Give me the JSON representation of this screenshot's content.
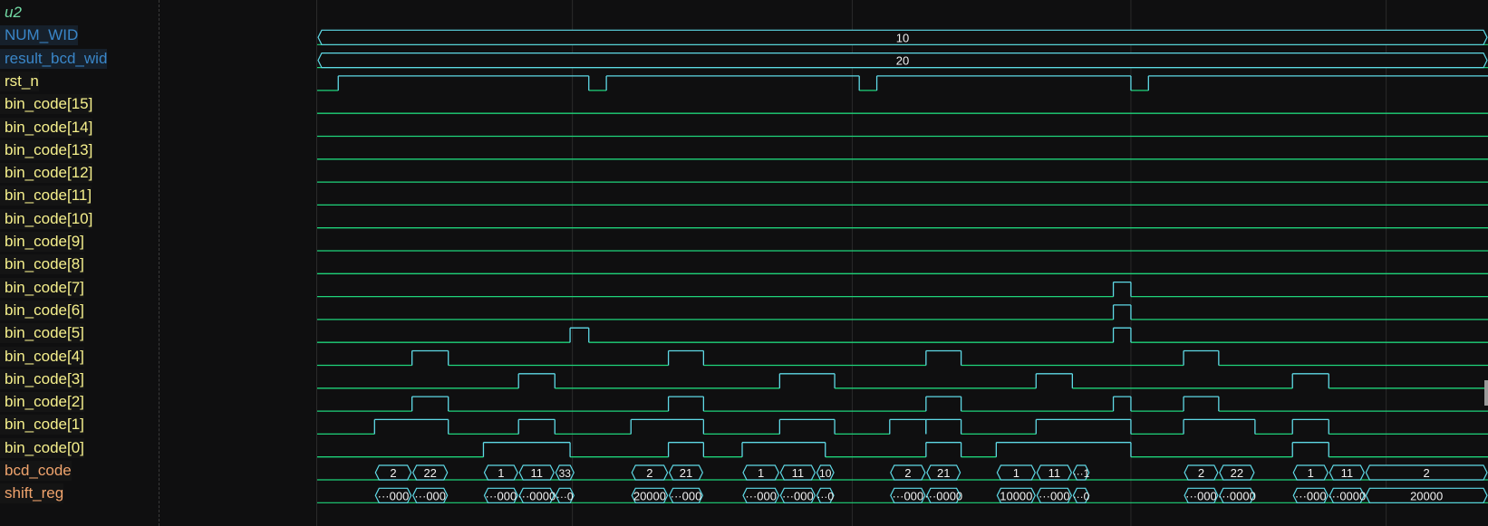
{
  "signals": [
    {
      "name": "u2",
      "kind": "group"
    },
    {
      "name": "NUM_WID",
      "kind": "param",
      "wave": "bus",
      "segments": [
        {
          "t": [
            0,
            1
          ],
          "v": "10"
        }
      ]
    },
    {
      "name": "result_bcd_wid",
      "kind": "param",
      "wave": "bus",
      "segments": [
        {
          "t": [
            0,
            1
          ],
          "v": "20"
        }
      ]
    },
    {
      "name": "rst_n",
      "kind": "sig",
      "wave": "bit",
      "init": 0,
      "edges": [
        0.018,
        0.232,
        0.247,
        0.463,
        0.478,
        0.695,
        0.71
      ]
    },
    {
      "name": "bin_code[15]",
      "kind": "sig",
      "wave": "bit",
      "init": 0,
      "edges": []
    },
    {
      "name": "bin_code[14]",
      "kind": "sig",
      "wave": "bit",
      "init": 0,
      "edges": []
    },
    {
      "name": "bin_code[13]",
      "kind": "sig",
      "wave": "bit",
      "init": 0,
      "edges": []
    },
    {
      "name": "bin_code[12]",
      "kind": "sig",
      "wave": "bit",
      "init": 0,
      "edges": []
    },
    {
      "name": "bin_code[11]",
      "kind": "sig",
      "wave": "bit",
      "init": 0,
      "edges": []
    },
    {
      "name": "bin_code[10]",
      "kind": "sig",
      "wave": "bit",
      "init": 0,
      "edges": []
    },
    {
      "name": "bin_code[9]",
      "kind": "sig",
      "wave": "bit",
      "init": 0,
      "edges": []
    },
    {
      "name": "bin_code[8]",
      "kind": "sig",
      "wave": "bit",
      "init": 0,
      "edges": []
    },
    {
      "name": "bin_code[7]",
      "kind": "sig",
      "wave": "bit",
      "init": 0,
      "edges": [
        0.68,
        0.695
      ]
    },
    {
      "name": "bin_code[6]",
      "kind": "sig",
      "wave": "bit",
      "init": 0,
      "edges": [
        0.68,
        0.695
      ]
    },
    {
      "name": "bin_code[5]",
      "kind": "sig",
      "wave": "bit",
      "init": 0,
      "edges": [
        0.216,
        0.232,
        0.68,
        0.695
      ]
    },
    {
      "name": "bin_code[4]",
      "kind": "sig",
      "wave": "bit",
      "init": 0,
      "edges": [
        0.081,
        0.112,
        0.3,
        0.33,
        0.52,
        0.55,
        0.74,
        0.77
      ]
    },
    {
      "name": "bin_code[3]",
      "kind": "sig",
      "wave": "bit",
      "init": 0,
      "edges": [
        0.172,
        0.203,
        0.395,
        0.442,
        0.614,
        0.645,
        0.833,
        0.864
      ]
    },
    {
      "name": "bin_code[2]",
      "kind": "sig",
      "wave": "bit",
      "init": 0,
      "edges": [
        0.081,
        0.112,
        0.3,
        0.33,
        0.52,
        0.55,
        0.68,
        0.695,
        0.74,
        0.77
      ]
    },
    {
      "name": "bin_code[1]",
      "kind": "sig",
      "wave": "bit",
      "init": 0,
      "edges": [
        0.049,
        0.112,
        0.172,
        0.203,
        0.268,
        0.33,
        0.395,
        0.442,
        0.489,
        0.52,
        0.52,
        0.55,
        0.614,
        0.695,
        0.74,
        0.801,
        0.833,
        0.864
      ]
    },
    {
      "name": "bin_code[0]",
      "kind": "sig",
      "wave": "bit",
      "init": 0,
      "edges": [
        0.142,
        0.216,
        0.3,
        0.33,
        0.363,
        0.434,
        0.52,
        0.55,
        0.58,
        0.695,
        0.833,
        0.864
      ]
    },
    {
      "name": "bcd_code",
      "kind": "bus",
      "wave": "bus",
      "segments": [
        {
          "t": [
            0.049,
            0.081
          ],
          "v": "2"
        },
        {
          "t": [
            0.081,
            0.112
          ],
          "v": "22"
        },
        {
          "t": [
            0.142,
            0.172
          ],
          "v": "1"
        },
        {
          "t": [
            0.172,
            0.203
          ],
          "v": "11"
        },
        {
          "t": [
            0.203,
            0.22
          ],
          "v": "33"
        },
        {
          "t": [
            0.268,
            0.3
          ],
          "v": "2"
        },
        {
          "t": [
            0.3,
            0.33
          ],
          "v": "21"
        },
        {
          "t": [
            0.363,
            0.395
          ],
          "v": "1"
        },
        {
          "t": [
            0.395,
            0.426
          ],
          "v": "11"
        },
        {
          "t": [
            0.426,
            0.442
          ],
          "v": "10"
        },
        {
          "t": [
            0.489,
            0.52
          ],
          "v": "2"
        },
        {
          "t": [
            0.52,
            0.55
          ],
          "v": "21"
        },
        {
          "t": [
            0.58,
            0.614
          ],
          "v": "1"
        },
        {
          "t": [
            0.614,
            0.645
          ],
          "v": "11"
        },
        {
          "t": [
            0.645,
            0.66
          ],
          "v": "···1"
        },
        {
          "t": [
            0.74,
            0.77
          ],
          "v": "2"
        },
        {
          "t": [
            0.77,
            0.801
          ],
          "v": "22"
        },
        {
          "t": [
            0.833,
            0.864
          ],
          "v": "1"
        },
        {
          "t": [
            0.864,
            0.895
          ],
          "v": "11"
        },
        {
          "t": [
            0.895,
            1.0
          ],
          "v": "2"
        }
      ]
    },
    {
      "name": "shift_reg",
      "kind": "bus",
      "wave": "bus",
      "segments": [
        {
          "t": [
            0.049,
            0.081
          ],
          "v": "···000"
        },
        {
          "t": [
            0.081,
            0.112
          ],
          "v": "···000"
        },
        {
          "t": [
            0.142,
            0.172
          ],
          "v": "···000"
        },
        {
          "t": [
            0.172,
            0.203
          ],
          "v": "···0000"
        },
        {
          "t": [
            0.203,
            0.22
          ],
          "v": "···0"
        },
        {
          "t": [
            0.268,
            0.3
          ],
          "v": "20000"
        },
        {
          "t": [
            0.3,
            0.33
          ],
          "v": "···000"
        },
        {
          "t": [
            0.363,
            0.395
          ],
          "v": "···000"
        },
        {
          "t": [
            0.395,
            0.426
          ],
          "v": "···000"
        },
        {
          "t": [
            0.426,
            0.442
          ],
          "v": "···0"
        },
        {
          "t": [
            0.489,
            0.52
          ],
          "v": "···000"
        },
        {
          "t": [
            0.52,
            0.55
          ],
          "v": "···0000"
        },
        {
          "t": [
            0.58,
            0.614
          ],
          "v": "10000"
        },
        {
          "t": [
            0.614,
            0.645
          ],
          "v": "···000"
        },
        {
          "t": [
            0.645,
            0.66
          ],
          "v": "···0"
        },
        {
          "t": [
            0.74,
            0.77
          ],
          "v": "···000"
        },
        {
          "t": [
            0.77,
            0.801
          ],
          "v": "···0000"
        },
        {
          "t": [
            0.833,
            0.864
          ],
          "v": "···000"
        },
        {
          "t": [
            0.864,
            0.895
          ],
          "v": "···0000"
        },
        {
          "t": [
            0.895,
            1.0
          ],
          "v": "20000"
        }
      ]
    }
  ],
  "colors": {
    "background": "#0f0f10",
    "trace": "#1fd37a",
    "high": "#5fd9e6",
    "bus_text": "#f2f2f2",
    "grid": "#2a2a2a",
    "cursor": "#3c4a3c"
  },
  "cursor_times": [
    0.218,
    0.457,
    0.695,
    0.913
  ]
}
